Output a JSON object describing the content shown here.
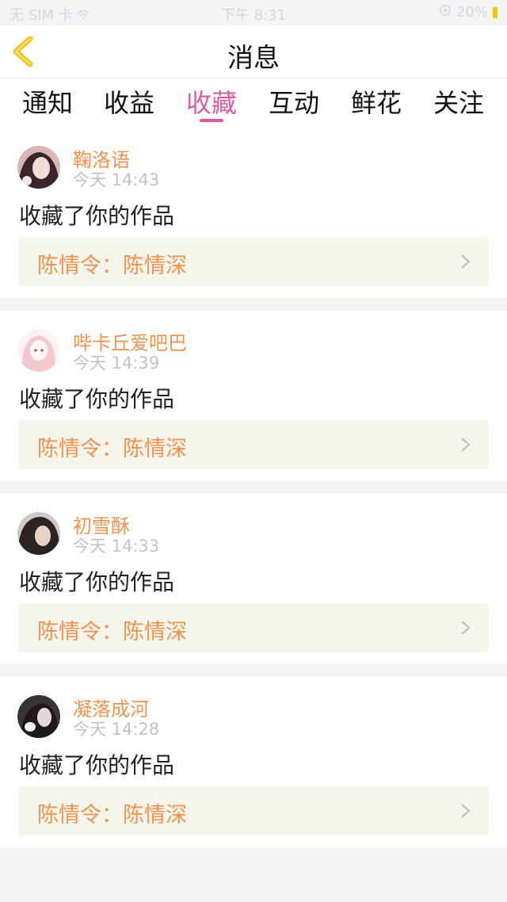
{
  "status_bar": {
    "carrier": "无 SIM 卡",
    "time": "下午 8:31",
    "battery": "20%"
  },
  "header": {
    "title": "消息"
  },
  "tabs": [
    {
      "label": "通知"
    },
    {
      "label": "收益"
    },
    {
      "label": "收藏"
    },
    {
      "label": "互动"
    },
    {
      "label": "鲜花"
    },
    {
      "label": "关注"
    }
  ],
  "active_tab": "收藏",
  "messages": [
    {
      "user": "鞠洛语",
      "time": "今天 14:43",
      "action": "收藏了你的作品",
      "work": "陈情令：陈情深"
    },
    {
      "user": "哔卡丘爱吧巴",
      "time": "今天 14:39",
      "action": "收藏了你的作品",
      "work": "陈情令：陈情深"
    },
    {
      "user": "初雪酥",
      "time": "今天 14:33",
      "action": "收藏了你的作品",
      "work": "陈情令：陈情深"
    },
    {
      "user": "凝落成河",
      "time": "今天 14:28",
      "action": "收藏了你的作品",
      "work": "陈情令：陈情深"
    }
  ],
  "colors": {
    "accent_pink": "#e05aa1",
    "username_orange": "#f2924f",
    "back_arrow": "#f4c21a"
  }
}
